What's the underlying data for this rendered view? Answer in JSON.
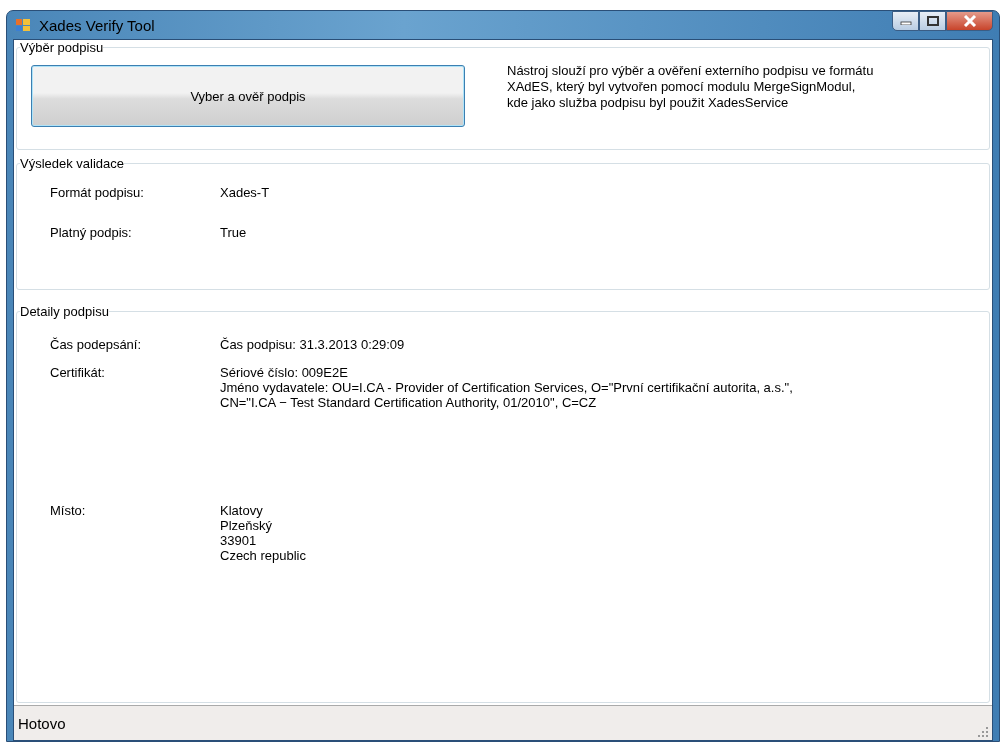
{
  "window": {
    "title": "Xades Verify Tool"
  },
  "selection": {
    "title": "Výběr podpisu",
    "button": "Vyber a ověř podpis",
    "description": [
      "Nástroj slouží pro výběr a ověření externího podpisu ve formátu",
      "XAdES, který byl vytvořen pomocí modulu MergeSignModul,",
      "kde jako služba podpisu byl použit XadesService"
    ]
  },
  "validation": {
    "title": "Výsledek validace",
    "rows": [
      {
        "label": "Formát podpisu:",
        "value": "Xades-T"
      },
      {
        "label": "Platný podpis:",
        "value": "True"
      }
    ]
  },
  "details": {
    "title": "Detaily podpisu",
    "rows": [
      {
        "label": "Čas podepsání:",
        "lines": [
          "Čas podpisu: 31.3.2013 0:29:09"
        ]
      },
      {
        "label": "Certifikát:",
        "lines": [
          "Sériové číslo: 009E2E",
          "Jméno vydavatele: OU=I.CA - Provider of Certification Services, O=\"První certifikační autorita, a.s.\",",
          "CN=\"I.CA − Test Standard Certification Authority, 01/2010\", C=CZ"
        ]
      },
      {
        "label": "Místo:",
        "lines": [
          "Klatovy",
          "Plzeňský",
          "33901",
          "Czech republic"
        ]
      }
    ]
  },
  "status_bar": {
    "text": "Hotovo"
  }
}
